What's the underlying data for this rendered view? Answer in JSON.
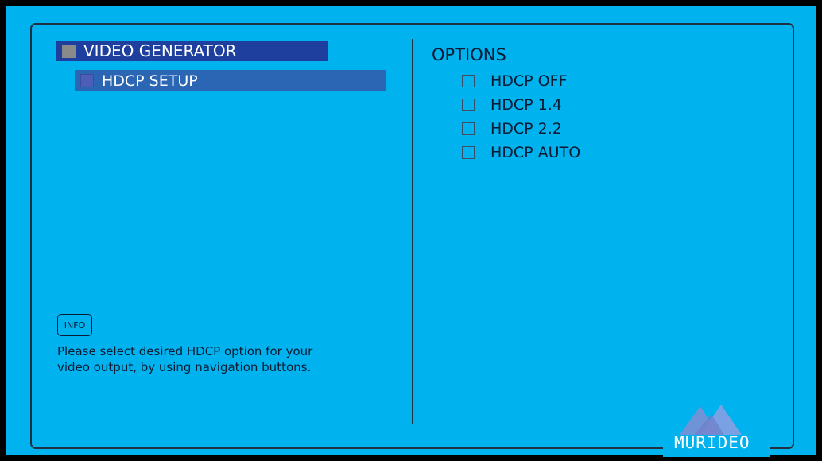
{
  "menu": {
    "level1_label": "VIDEO GENERATOR",
    "level2_label": "HDCP SETUP"
  },
  "options": {
    "title": "OPTIONS",
    "items": [
      {
        "label": "HDCP OFF",
        "checked": false
      },
      {
        "label": "HDCP 1.4",
        "checked": false
      },
      {
        "label": "HDCP 2.2",
        "checked": false
      },
      {
        "label": "HDCP AUTO",
        "checked": false
      }
    ]
  },
  "info": {
    "badge": "INFO",
    "line1": "Please select desired HDCP option for your",
    "line2": "video output, by using navigation buttons."
  },
  "brand": {
    "name": "MURIDEO"
  },
  "colors": {
    "background": "#00b2ee",
    "menu_level1": "#1e3f9e",
    "menu_level2": "#2b66b4",
    "text_dark": "#0b1b33"
  }
}
